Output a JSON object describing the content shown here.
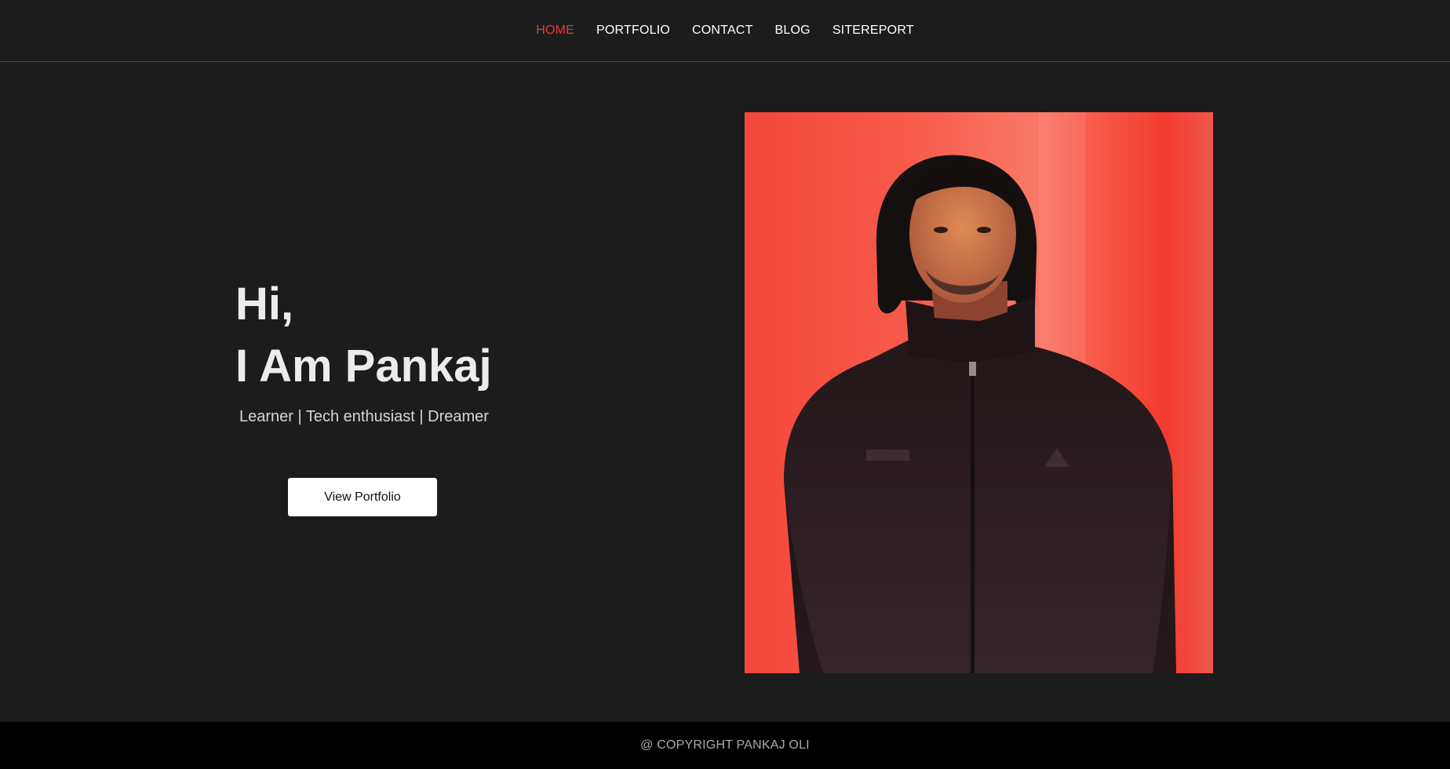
{
  "nav": {
    "items": [
      {
        "label": "HOME",
        "active": true
      },
      {
        "label": "PORTFOLIO",
        "active": false
      },
      {
        "label": "CONTACT",
        "active": false
      },
      {
        "label": "BLOG",
        "active": false
      },
      {
        "label": "SITEREPORT",
        "active": false
      }
    ],
    "active_color": "#e53935"
  },
  "hero": {
    "greeting": "Hi,",
    "name": "I Am Pankaj",
    "tagline": "Learner | Tech enthusiast | Dreamer",
    "cta_label": "View Portfolio"
  },
  "portrait": {
    "subject": "person in dark zip jacket against red wall",
    "background_color": "#f75848",
    "jacket_color": "#2a1c1e"
  },
  "footer": {
    "copyright": "@ COPYRIGHT PANKAJ OLI"
  },
  "colors": {
    "page_background": "#1c1c1c",
    "footer_background": "#000000",
    "button_background": "#ffffff"
  }
}
